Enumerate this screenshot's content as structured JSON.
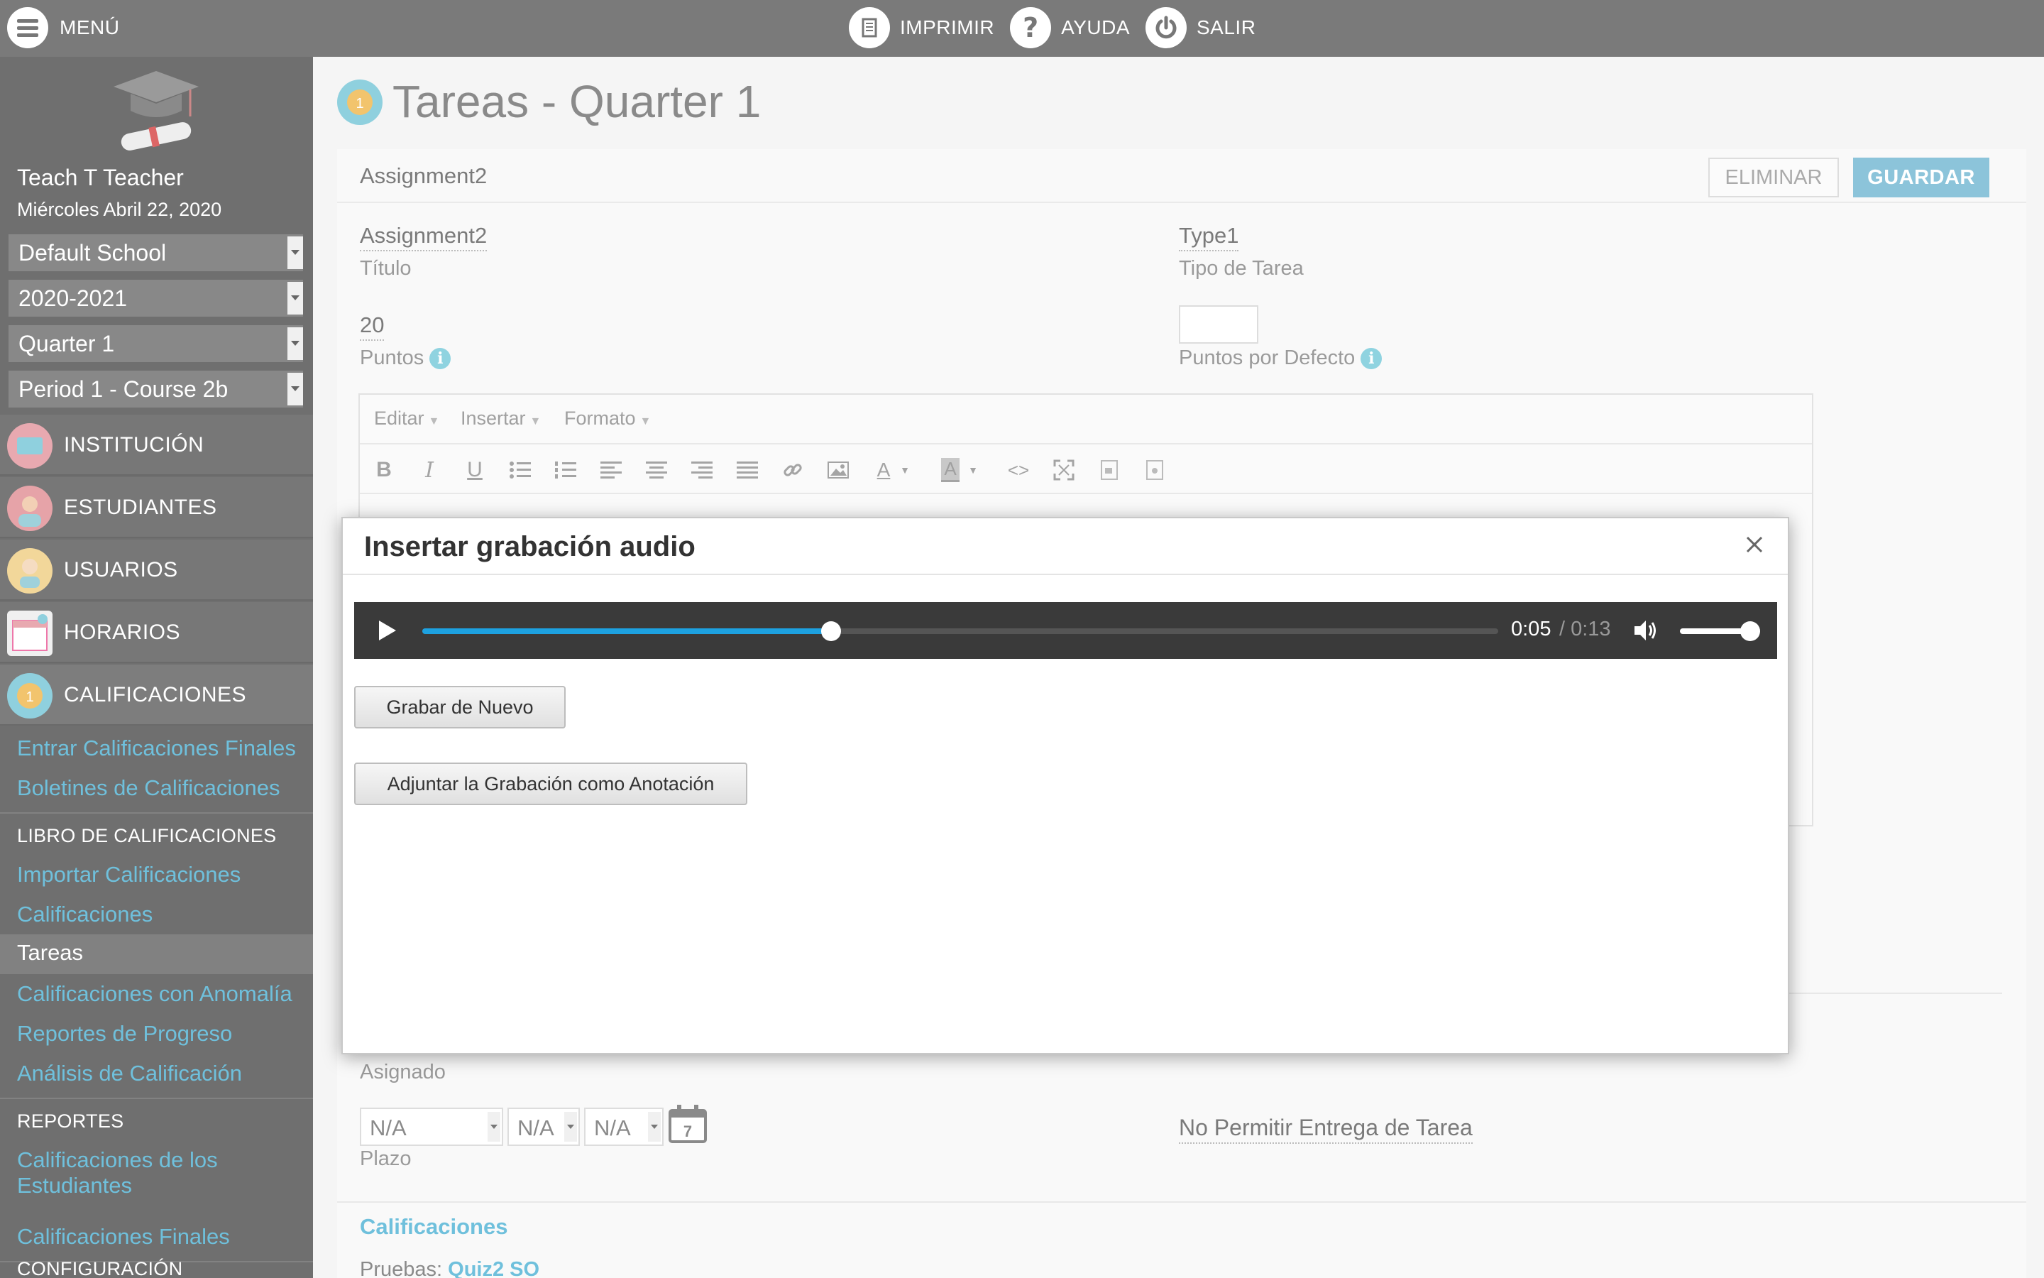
{
  "topbar": {
    "menu_label": "MENÚ",
    "print_label": "IMPRIMIR",
    "help_label": "AYUDA",
    "exit_label": "SALIR"
  },
  "sidebar": {
    "user_name": "Teach T Teacher",
    "date": "Miércoles Abril 22, 2020",
    "selects": [
      "Default School",
      "2020-2021",
      "Quarter 1",
      "Period 1 - Course 2b"
    ],
    "nav": [
      {
        "label": "INSTITUCIÓN",
        "icon": "institution-icon"
      },
      {
        "label": "ESTUDIANTES",
        "icon": "students-icon"
      },
      {
        "label": "USUARIOS",
        "icon": "users-icon"
      },
      {
        "label": "HORARIOS",
        "icon": "schedule-icon"
      },
      {
        "label": "CALIFICACIONES",
        "icon": "grades-icon"
      }
    ],
    "grades_links": [
      "Entrar Calificaciones Finales",
      "Boletines de Calificaciones"
    ],
    "gradebook_heading": "LIBRO DE CALIFICACIONES",
    "gradebook_links": [
      "Importar Calificaciones",
      "Calificaciones"
    ],
    "active_item": "Tareas",
    "gradebook_links_2": [
      "Calificaciones con Anomalía",
      "Reportes de Progreso",
      "Análisis de Calificación"
    ],
    "reports_heading": "REPORTES",
    "reports_links": [
      "Calificaciones de los Estudiantes",
      "Calificaciones Finales"
    ],
    "config_heading": "CONFIGURACIÓN"
  },
  "main": {
    "page_title": "Tareas - Quarter 1",
    "panel_title": "Assignment2",
    "delete_label": "ELIMINAR",
    "save_label": "GUARDAR",
    "fields": {
      "title_value": "Assignment2",
      "title_label": "Título",
      "type_value": "Type1",
      "type_label": "Tipo de Tarea",
      "points_value": "20",
      "points_label": "Puntos",
      "default_points_label": "Puntos por Defecto",
      "default_points_value": ""
    },
    "editor": {
      "menus": [
        "Editar",
        "Insertar",
        "Formato"
      ]
    },
    "assigned_label": "Asignado",
    "due": {
      "values": [
        "N/A",
        "N/A",
        "N/A"
      ],
      "calendar_day": "7",
      "label": "Plazo"
    },
    "no_submission_label": "No Permitir Entrega de Tarea",
    "grades_section": "Calificaciones",
    "tests_label": "Pruebas:",
    "tests_link": "Quiz2 SO"
  },
  "modal": {
    "title": "Insertar grabación audio",
    "player": {
      "current_time": "0:05",
      "duration": "/ 0:13",
      "progress": 0.38,
      "volume": 0.9
    },
    "record_again_label": "Grabar de Nuevo",
    "attach_label": "Adjuntar la Grabación como Anotación"
  },
  "colors": {
    "accent": "#6fc0dc",
    "save_button": "#8cc4da",
    "progress": "#1da1e0"
  }
}
